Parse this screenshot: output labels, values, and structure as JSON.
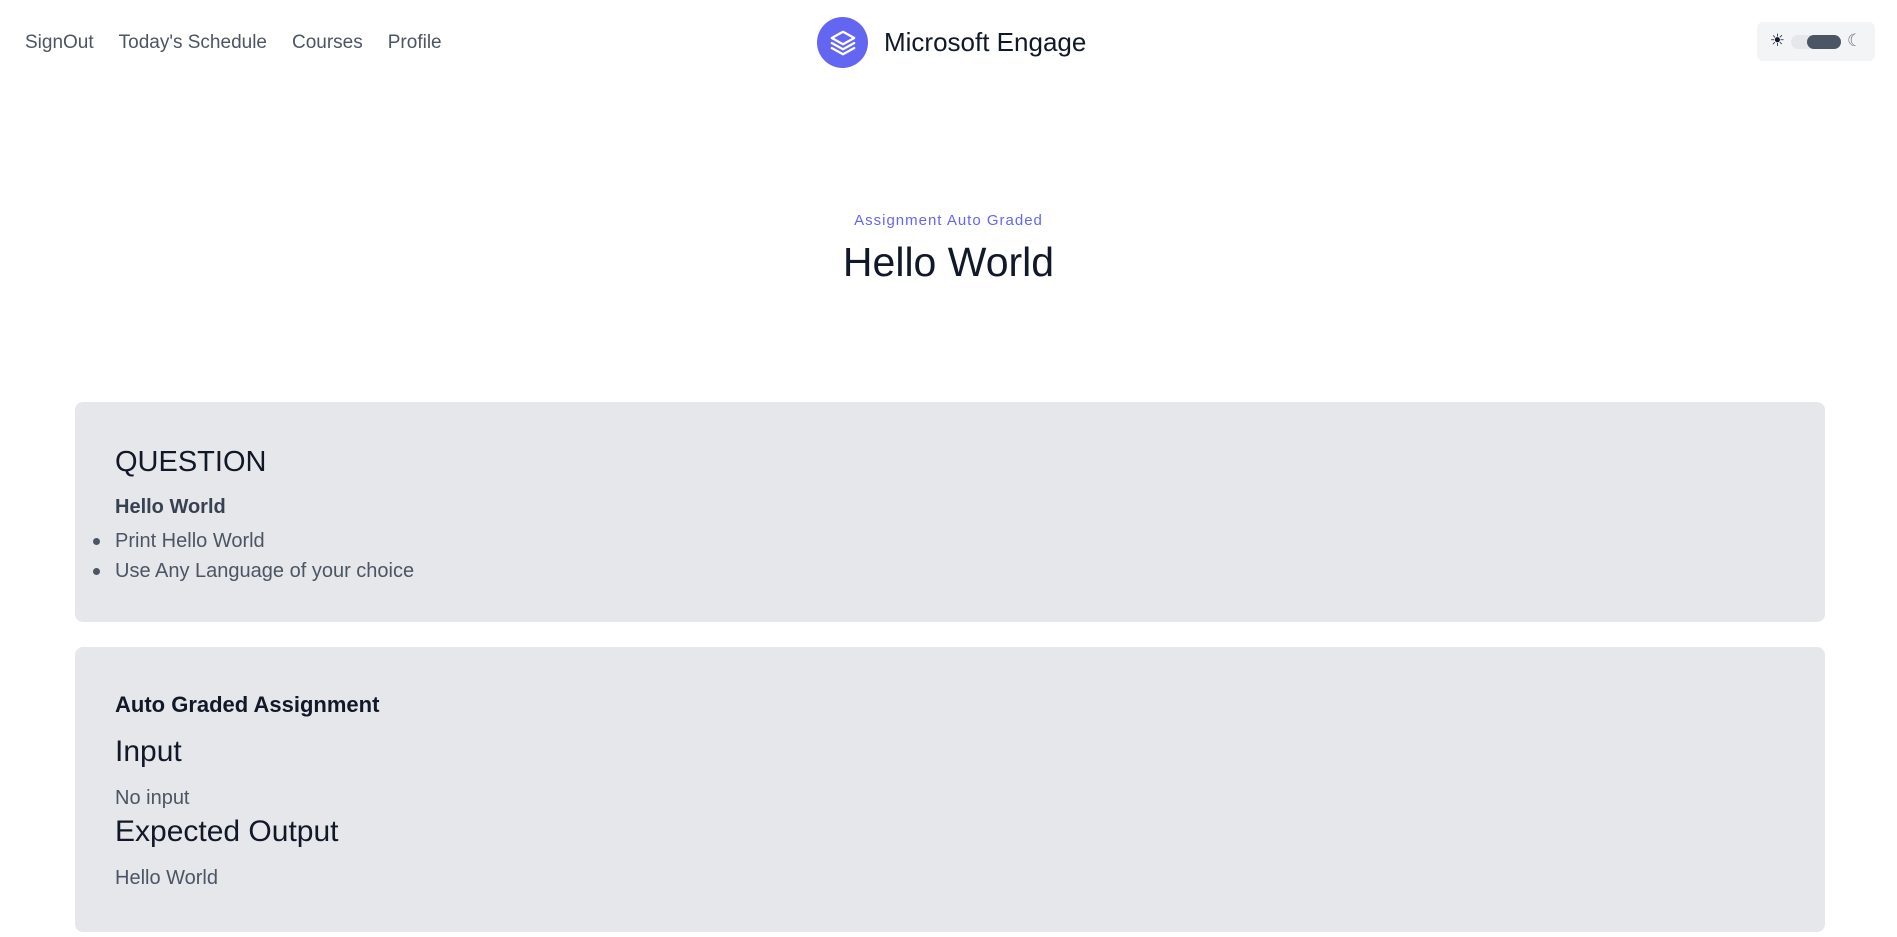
{
  "nav": {
    "items": [
      {
        "label": "SignOut"
      },
      {
        "label": "Today's Schedule"
      },
      {
        "label": "Courses"
      },
      {
        "label": "Profile"
      }
    ]
  },
  "brand": {
    "name": "Microsoft Engage",
    "logo_icon": "layers-icon",
    "accent_color": "#6366f1"
  },
  "theme_toggle": {
    "sun_icon": "☀",
    "moon_icon": "☾",
    "mode": "dark"
  },
  "hero": {
    "eyebrow": "Assignment Auto Graded",
    "title": "Hello World"
  },
  "question_card": {
    "heading": "QUESTION",
    "subtitle": "Hello World",
    "items": [
      "Print Hello World",
      "Use Any Language of your choice"
    ]
  },
  "auto_card": {
    "heading": "Auto Graded Assignment",
    "input_label": "Input",
    "input_value": "No input",
    "output_label": "Expected Output",
    "output_value": "Hello World"
  }
}
